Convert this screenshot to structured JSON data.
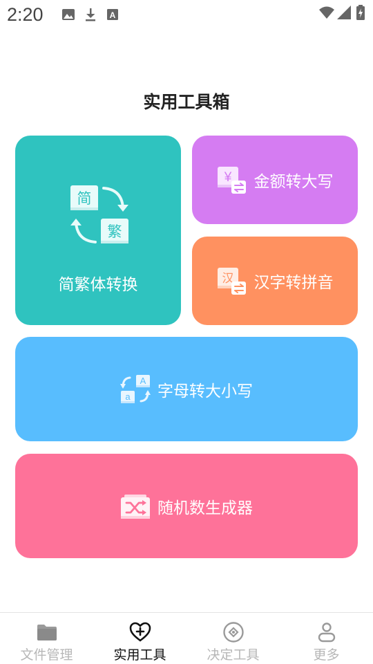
{
  "status_bar": {
    "time": "2:20",
    "icons": [
      "image-icon",
      "download-icon",
      "font-a-icon",
      "wifi-icon",
      "signal-icon",
      "battery-icon"
    ]
  },
  "page": {
    "title": "实用工具箱"
  },
  "tools": {
    "jianfan": {
      "label": "简繁体转换",
      "icon": "simplified-traditional-icon",
      "color": "#2fc3bf",
      "glyph_1": "简",
      "glyph_2": "繁"
    },
    "jine": {
      "label": "金额转大写",
      "icon": "yuan-convert-icon",
      "color": "#d57cf2",
      "glyph": "¥"
    },
    "hanzi": {
      "label": "汉字转拼音",
      "icon": "hanzi-convert-icon",
      "color": "#ff9160",
      "glyph": "汉"
    },
    "zimu": {
      "label": "字母转大小写",
      "icon": "letter-case-icon",
      "color": "#58bdfe",
      "glyph_upper": "A",
      "glyph_lower": "a"
    },
    "suiji": {
      "label": "随机数生成器",
      "icon": "shuffle-icon",
      "color": "#fe7299"
    }
  },
  "nav": {
    "items": [
      {
        "label": "文件管理",
        "icon": "folder-icon",
        "active": false
      },
      {
        "label": "实用工具",
        "icon": "heart-plus-icon",
        "active": true
      },
      {
        "label": "决定工具",
        "icon": "compass-icon",
        "active": false
      },
      {
        "label": "更多",
        "icon": "user-icon",
        "active": false
      }
    ]
  }
}
